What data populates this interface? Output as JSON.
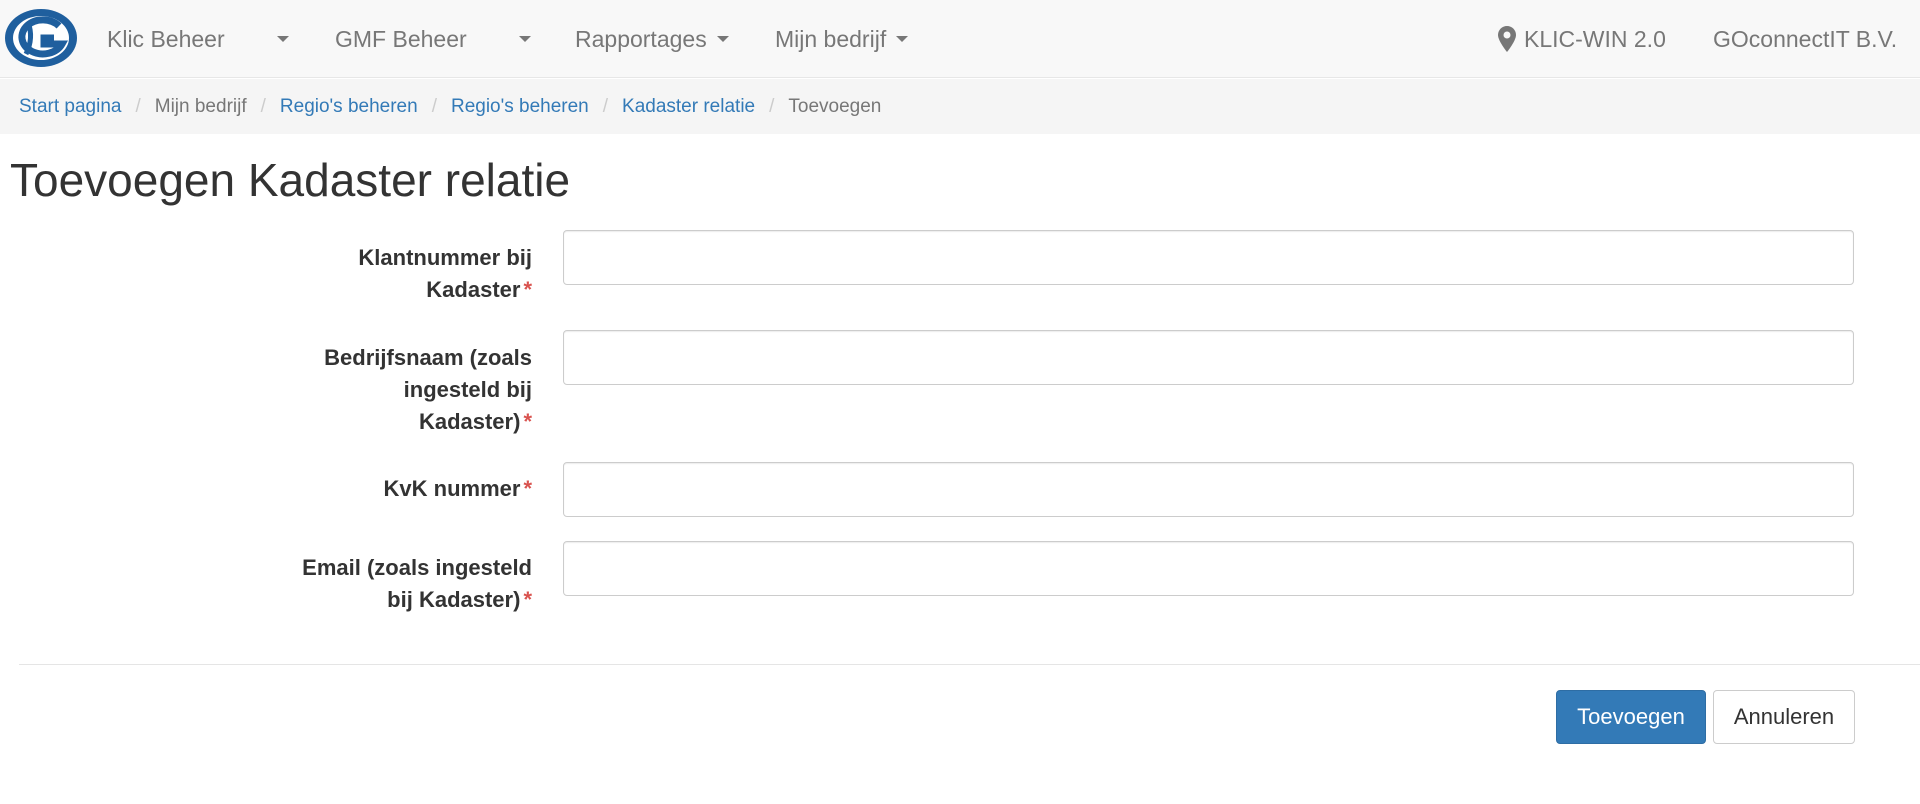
{
  "navbar": {
    "menu": [
      {
        "label": "Klic Beheer"
      },
      {
        "label": "GMF Beheer"
      },
      {
        "label": "Rapportages"
      },
      {
        "label": "Mijn bedrijf"
      }
    ],
    "app_version": "KLIC-WIN 2.0",
    "company": "GOconnectIT B.V.",
    "icons": {
      "location": "map-marker-icon",
      "dropdown": "caret-down-icon"
    }
  },
  "breadcrumb": {
    "items": [
      {
        "label": "Start pagina",
        "link": true
      },
      {
        "label": "Mijn bedrijf",
        "link": false
      },
      {
        "label": "Regio's beheren",
        "link": true
      },
      {
        "label": "Regio's beheren",
        "link": true
      },
      {
        "label": "Kadaster relatie",
        "link": true
      },
      {
        "label": "Toevoegen",
        "link": false
      }
    ]
  },
  "page": {
    "title": "Toevoegen Kadaster relatie"
  },
  "form": {
    "fields": [
      {
        "label_lines": [
          "Klantnummer bij",
          "Kadaster"
        ],
        "required_mark": "*",
        "value": ""
      },
      {
        "label_lines": [
          "Bedrijfsnaam (zoals",
          "ingesteld bij",
          "Kadaster)"
        ],
        "required_mark": "*",
        "value": ""
      },
      {
        "label_lines": [
          "KvK nummer"
        ],
        "required_mark": "*",
        "value": ""
      },
      {
        "label_lines": [
          "Email (zoals ingesteld",
          "bij Kadaster)"
        ],
        "required_mark": "*",
        "value": ""
      }
    ],
    "submit_label": "Toevoegen",
    "cancel_label": "Annuleren"
  },
  "colors": {
    "primary": "#337ab7",
    "link": "#337ab7",
    "required": "#d9534f",
    "navbar_bg": "#f8f8f8"
  }
}
